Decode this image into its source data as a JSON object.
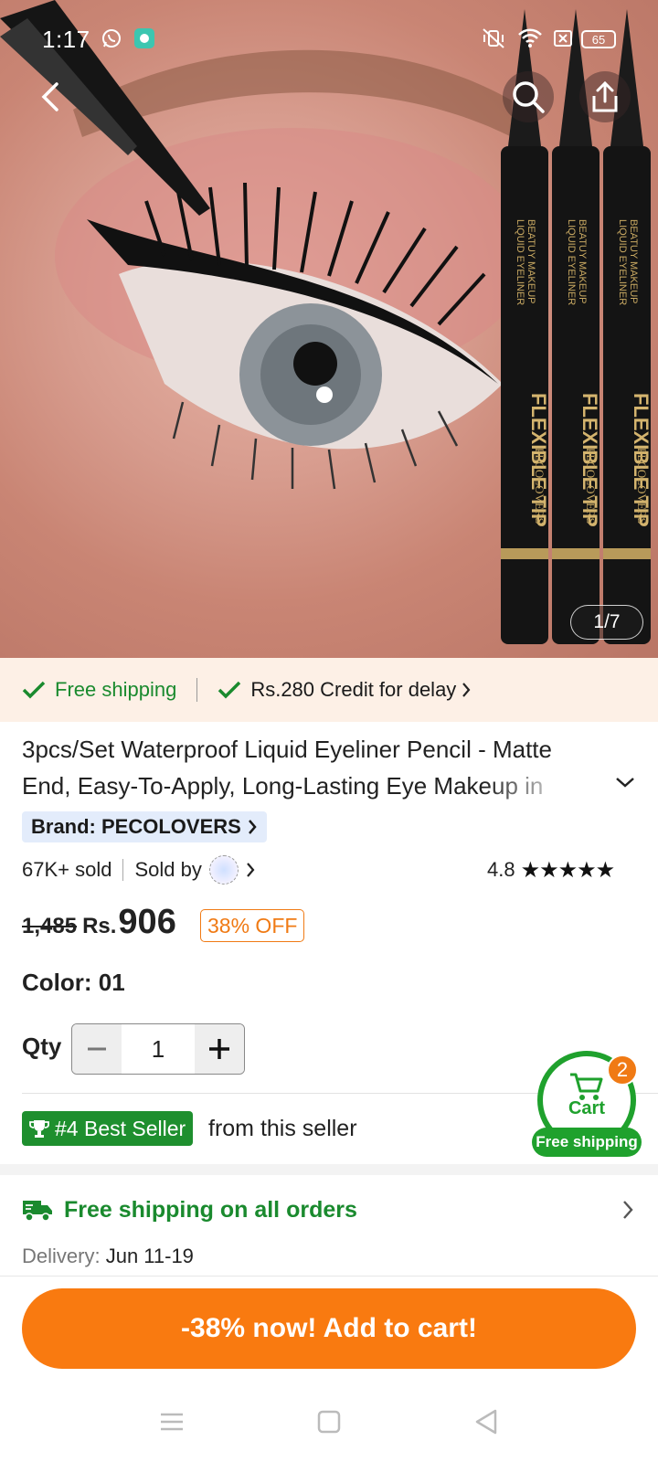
{
  "status_bar": {
    "time": "1:17",
    "battery": "65"
  },
  "gallery": {
    "counter": "1/7",
    "pen_brand": "PECOLOVERS",
    "pen_line1": "LIQUID EYELINER",
    "pen_line2": "BEATUY MAKEUP",
    "pen_tagline": "FLEXIBLE TIP"
  },
  "banner": {
    "free_shipping": "Free shipping",
    "credit": "Rs.280 Credit for delay"
  },
  "product": {
    "title": "3pcs/Set Waterproof Liquid Eyeliner Pencil - Matte End, Easy-To-Apply, Long-Lasting Eye Makeup in",
    "brand": "Brand: PECOLOVERS",
    "sold": "67K+ sold",
    "sold_by": "Sold by",
    "rating": "4.8",
    "stars": "★★★★★",
    "old_price": "1,485",
    "currency": "Rs.",
    "price": "906",
    "discount": "38% OFF",
    "color": "Color: 01",
    "qty_label": "Qty",
    "qty_value": "1",
    "bestseller": "#4 Best Seller",
    "bestseller_suffix": "from this seller"
  },
  "cart": {
    "label": "Cart",
    "count": "2",
    "free_shipping": "Free shipping"
  },
  "shipping": {
    "title": "Free shipping on all orders",
    "delivery_label": "Delivery:",
    "delivery_date": "Jun 11-19"
  },
  "cta": {
    "label": "-38% now! Add to cart!"
  },
  "colors": {
    "accent_orange": "#f97a10",
    "green": "#1a8a2e",
    "banner_bg": "#fdf0e6"
  }
}
